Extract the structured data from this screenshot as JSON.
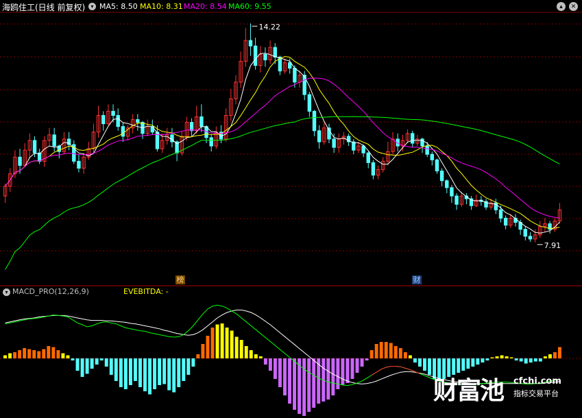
{
  "header": {
    "title": "海鸥住工(日线 前复权)",
    "ma5": "MA5: 8.50",
    "ma10": "MA10: 8.31",
    "ma20": "MA20: 8.54",
    "ma60": "MA60: 9.55",
    "ma5_color": "#ffffff",
    "ma10_color": "#ffff00",
    "ma20_color": "#ff00ff",
    "ma60_color": "#00ff00"
  },
  "panel2": {
    "title": "MACD_PRO(12,26,9)",
    "indicator": "EVEBITDA: -"
  },
  "markers": {
    "bang": "榜",
    "cai": "财"
  },
  "watermark": {
    "brand": "财富池",
    "domain": "cfchi.com",
    "slogan": "指标交易平台"
  },
  "icons": [
    "chevron-down-icon",
    "up-icon",
    "close-icon"
  ],
  "colors": {
    "up": "#ff3232",
    "down": "#54ffff",
    "grid": "#7f0000",
    "hist_up_1": "#ff6a00",
    "hist_up_2": "#ffff00",
    "hist_down_1": "#54ffff",
    "hist_down_2": "#cc66ff"
  },
  "chart_data": [
    {
      "type": "candlestick",
      "title": "海鸥住工(日线 前复权)",
      "annotations": [
        {
          "label": "14.22",
          "note": "high"
        },
        {
          "label": "7.91",
          "note": "low"
        }
      ],
      "ylim": [
        7.0,
        14.5
      ],
      "series": [
        {
          "name": "MA5",
          "value": 8.5
        },
        {
          "name": "MA10",
          "value": 8.31
        },
        {
          "name": "MA20",
          "value": 8.54
        },
        {
          "name": "MA60",
          "value": 9.55
        }
      ],
      "candles": [
        [
          9.25,
          9.53,
          9.05,
          9.61
        ],
        [
          9.53,
          9.89,
          9.37,
          10.05
        ],
        [
          9.89,
          10.37,
          9.77,
          10.57
        ],
        [
          10.37,
          10.13,
          9.89,
          10.61
        ],
        [
          10.13,
          10.57,
          10.09,
          10.77
        ],
        [
          10.57,
          10.85,
          10.33,
          11.05
        ],
        [
          10.85,
          10.49,
          10.37,
          10.97
        ],
        [
          10.49,
          10.25,
          10.17,
          10.61
        ],
        [
          10.25,
          10.85,
          10.09,
          10.97
        ],
        [
          10.85,
          11.01,
          10.69,
          11.21
        ],
        [
          11.01,
          10.69,
          10.53,
          11.21
        ],
        [
          10.69,
          10.53,
          10.33,
          10.73
        ],
        [
          10.53,
          10.89,
          10.45,
          11.09
        ],
        [
          10.89,
          10.73,
          10.57,
          11.09
        ],
        [
          10.73,
          10.25,
          10.17,
          10.85
        ],
        [
          10.25,
          10.05,
          9.93,
          10.45
        ],
        [
          10.05,
          10.37,
          9.89,
          10.49
        ],
        [
          10.37,
          10.61,
          10.29,
          10.81
        ],
        [
          10.61,
          11.09,
          10.49,
          11.33
        ],
        [
          11.09,
          11.57,
          10.93,
          11.85
        ],
        [
          11.57,
          11.33,
          11.13,
          11.69
        ],
        [
          11.33,
          11.69,
          11.29,
          11.89
        ],
        [
          11.69,
          11.57,
          11.37,
          11.89
        ],
        [
          11.57,
          11.25,
          11.13,
          11.77
        ],
        [
          11.25,
          10.97,
          10.81,
          11.37
        ],
        [
          10.97,
          11.21,
          10.85,
          11.29
        ],
        [
          11.21,
          11.45,
          11.05,
          11.61
        ],
        [
          11.45,
          11.37,
          11.13,
          11.61
        ],
        [
          11.37,
          11.05,
          10.89,
          11.41
        ],
        [
          11.05,
          11.25,
          10.97,
          11.45
        ],
        [
          11.25,
          11.09,
          11.01,
          11.45
        ],
        [
          11.09,
          10.61,
          10.53,
          11.29
        ],
        [
          10.61,
          10.85,
          10.49,
          11.05
        ],
        [
          10.85,
          11.01,
          10.73,
          11.21
        ],
        [
          11.01,
          10.81,
          10.65,
          11.21
        ],
        [
          10.81,
          10.49,
          10.25,
          10.85
        ],
        [
          10.49,
          10.97,
          10.41,
          11.13
        ],
        [
          10.97,
          11.37,
          10.85,
          11.53
        ],
        [
          11.37,
          11.13,
          10.97,
          11.49
        ],
        [
          11.13,
          11.53,
          11.05,
          11.85
        ],
        [
          11.53,
          11.25,
          11.09,
          11.89
        ],
        [
          11.25,
          10.93,
          10.77,
          11.29
        ],
        [
          10.93,
          10.69,
          10.53,
          11.01
        ],
        [
          10.69,
          11.09,
          10.61,
          11.25
        ],
        [
          11.09,
          10.89,
          10.77,
          11.29
        ],
        [
          10.89,
          11.57,
          10.81,
          11.77
        ],
        [
          11.57,
          12.05,
          11.41,
          12.33
        ],
        [
          12.05,
          12.53,
          11.89,
          12.73
        ],
        [
          12.53,
          13.13,
          12.37,
          13.41
        ],
        [
          13.13,
          13.73,
          12.97,
          14.09
        ],
        [
          13.73,
          13.57,
          13.29,
          14.22
        ],
        [
          13.57,
          13.01,
          12.89,
          13.81
        ],
        [
          13.01,
          13.33,
          12.81,
          13.57
        ],
        [
          13.33,
          13.17,
          12.97,
          13.53
        ],
        [
          13.17,
          13.53,
          13.05,
          13.73
        ],
        [
          13.53,
          13.25,
          13.05,
          13.65
        ],
        [
          13.25,
          12.85,
          12.73,
          13.29
        ],
        [
          12.85,
          13.09,
          12.77,
          13.21
        ],
        [
          13.09,
          12.93,
          12.77,
          13.21
        ],
        [
          12.93,
          12.53,
          12.37,
          13.01
        ],
        [
          12.53,
          12.73,
          12.37,
          12.85
        ],
        [
          12.73,
          12.17,
          12.01,
          12.85
        ],
        [
          12.17,
          11.69,
          11.53,
          12.25
        ],
        [
          11.69,
          11.13,
          10.97,
          11.73
        ],
        [
          11.13,
          10.81,
          10.61,
          11.29
        ],
        [
          10.81,
          11.21,
          10.73,
          11.37
        ],
        [
          11.21,
          10.89,
          10.77,
          11.33
        ],
        [
          10.89,
          10.65,
          10.49,
          11.05
        ],
        [
          10.65,
          10.89,
          10.49,
          11.05
        ],
        [
          10.89,
          10.97,
          10.73,
          11.09
        ],
        [
          10.97,
          10.81,
          10.69,
          11.05
        ],
        [
          10.81,
          10.57,
          10.45,
          10.89
        ],
        [
          10.57,
          10.69,
          10.49,
          10.81
        ],
        [
          10.69,
          10.49,
          10.37,
          10.73
        ],
        [
          10.49,
          10.21,
          10.05,
          10.53
        ],
        [
          10.21,
          9.85,
          9.73,
          10.29
        ],
        [
          9.85,
          10.01,
          9.73,
          10.13
        ],
        [
          10.01,
          10.25,
          9.93,
          10.37
        ],
        [
          10.25,
          10.53,
          10.13,
          10.81
        ],
        [
          10.53,
          10.89,
          10.45,
          11.09
        ],
        [
          10.89,
          10.69,
          10.53,
          11.05
        ],
        [
          10.69,
          10.85,
          10.53,
          11.01
        ],
        [
          10.85,
          11.05,
          10.77,
          11.17
        ],
        [
          11.05,
          10.77,
          10.65,
          11.13
        ],
        [
          10.77,
          10.89,
          10.69,
          11.01
        ],
        [
          10.89,
          10.69,
          10.49,
          10.93
        ],
        [
          10.69,
          10.45,
          10.37,
          10.81
        ],
        [
          10.45,
          10.29,
          10.13,
          10.53
        ],
        [
          10.29,
          9.97,
          9.89,
          10.33
        ],
        [
          9.97,
          9.69,
          9.53,
          10.05
        ],
        [
          9.69,
          9.49,
          9.33,
          9.73
        ],
        [
          9.49,
          9.25,
          9.05,
          9.57
        ],
        [
          9.25,
          9.01,
          8.85,
          9.33
        ],
        [
          9.01,
          9.25,
          8.93,
          9.37
        ],
        [
          9.25,
          9.17,
          9.01,
          9.33
        ],
        [
          9.17,
          8.97,
          8.85,
          9.25
        ],
        [
          8.97,
          9.13,
          8.93,
          9.29
        ],
        [
          9.13,
          9.09,
          8.97,
          9.25
        ],
        [
          9.09,
          8.93,
          8.85,
          9.17
        ],
        [
          8.93,
          9.05,
          8.85,
          9.17
        ],
        [
          9.05,
          8.85,
          8.73,
          9.17
        ],
        [
          8.85,
          8.61,
          8.49,
          8.97
        ],
        [
          8.61,
          8.41,
          8.29,
          8.69
        ],
        [
          8.41,
          8.61,
          8.33,
          8.73
        ],
        [
          8.61,
          8.49,
          8.37,
          8.73
        ],
        [
          8.49,
          8.29,
          8.13,
          8.57
        ],
        [
          8.29,
          8.09,
          7.97,
          8.37
        ],
        [
          8.09,
          8.01,
          7.93,
          8.21
        ],
        [
          8.01,
          8.13,
          7.91,
          8.29
        ],
        [
          8.13,
          8.37,
          8.05,
          8.53
        ],
        [
          8.37,
          8.45,
          8.21,
          8.61
        ],
        [
          8.45,
          8.29,
          8.17,
          8.53
        ],
        [
          8.29,
          8.53,
          8.21,
          8.61
        ],
        [
          8.53,
          8.85,
          8.45,
          9.05
        ]
      ]
    },
    {
      "type": "bar",
      "title": "MACD_PRO(12,26,9)",
      "series": [
        {
          "name": "MACD",
          "values": [
            0.03,
            0.05,
            0.06,
            0.08,
            0.1,
            0.09,
            0.08,
            0.07,
            0.09,
            0.12,
            0.11,
            0.08,
            0.05,
            0.03,
            -0.02,
            -0.12,
            -0.18,
            -0.15,
            -0.1,
            -0.06,
            -0.02,
            -0.08,
            -0.16,
            -0.22,
            -0.28,
            -0.3,
            -0.26,
            -0.22,
            -0.28,
            -0.32,
            -0.35,
            -0.3,
            -0.26,
            -0.25,
            -0.31,
            -0.33,
            -0.28,
            -0.22,
            -0.16,
            -0.08,
            0.04,
            0.14,
            0.22,
            0.3,
            0.33,
            0.34,
            0.3,
            0.27,
            0.21,
            0.18,
            0.12,
            0.08,
            0.04,
            0.02,
            -0.06,
            -0.12,
            -0.2,
            -0.28,
            -0.36,
            -0.44,
            -0.5,
            -0.54,
            -0.56,
            -0.52,
            -0.48,
            -0.44,
            -0.42,
            -0.4,
            -0.36,
            -0.3,
            -0.26,
            -0.24,
            -0.2,
            -0.14,
            -0.08,
            -0.02,
            0.08,
            0.14,
            0.16,
            0.16,
            0.15,
            0.12,
            0.1,
            0.06,
            0.03,
            -0.04,
            -0.08,
            -0.12,
            -0.16,
            -0.2,
            -0.22,
            -0.2,
            -0.18,
            -0.16,
            -0.14,
            -0.12,
            -0.1,
            -0.08,
            -0.06,
            -0.04,
            -0.02,
            0.01,
            0.02,
            0.03,
            0.02,
            0.01,
            -0.02,
            -0.03,
            -0.05,
            -0.04,
            -0.03,
            -0.03,
            0.02,
            0.04,
            0.06,
            0.11
          ]
        },
        {
          "name": "DIF",
          "values": [
            0.7,
            0.72,
            0.74,
            0.76,
            0.78,
            0.8,
            0.81,
            0.82,
            0.84,
            0.86,
            0.88,
            0.87,
            0.86,
            0.84,
            0.78,
            0.72,
            0.68,
            0.64,
            0.66,
            0.7,
            0.73,
            0.74,
            0.72,
            0.7,
            0.66,
            0.62,
            0.6,
            0.58,
            0.56,
            0.55,
            0.52,
            0.5,
            0.48,
            0.46,
            0.44,
            0.43,
            0.44,
            0.48,
            0.56,
            0.66,
            0.78,
            0.9,
            1.0,
            1.06,
            1.08,
            1.06,
            1.02,
            0.96,
            0.9,
            0.82,
            0.74,
            0.66,
            0.58,
            0.5,
            0.42,
            0.34,
            0.26,
            0.18,
            0.1,
            0.02,
            -0.06,
            -0.14,
            -0.22,
            -0.28,
            -0.34,
            -0.4,
            -0.44,
            -0.48,
            -0.5,
            -0.52,
            -0.54,
            -0.55,
            -0.53,
            -0.5,
            -0.46,
            -0.4,
            -0.34,
            -0.28,
            -0.22,
            -0.18,
            -0.16,
            -0.16,
            -0.17,
            -0.2,
            -0.23,
            -0.27,
            -0.31,
            -0.35,
            -0.39,
            -0.43,
            -0.46,
            -0.48,
            -0.5,
            -0.51,
            -0.52,
            -0.53,
            -0.53,
            -0.53,
            -0.52,
            -0.51,
            -0.5,
            -0.49,
            -0.48,
            -0.48,
            -0.48,
            -0.49,
            -0.5,
            -0.51,
            -0.52,
            -0.52,
            -0.51,
            -0.5,
            -0.48,
            -0.46,
            -0.44,
            -0.42
          ]
        },
        {
          "name": "DEA",
          "values": [
            0.72,
            0.74,
            0.76,
            0.78,
            0.8,
            0.81,
            0.82,
            0.84,
            0.85,
            0.86,
            0.87,
            0.87,
            0.87,
            0.86,
            0.84,
            0.82,
            0.8,
            0.78,
            0.77,
            0.77,
            0.77,
            0.76,
            0.76,
            0.75,
            0.74,
            0.73,
            0.71,
            0.7,
            0.68,
            0.66,
            0.64,
            0.62,
            0.6,
            0.57,
            0.55,
            0.52,
            0.5,
            0.48,
            0.47,
            0.48,
            0.52,
            0.58,
            0.66,
            0.74,
            0.82,
            0.88,
            0.93,
            0.96,
            0.98,
            0.98,
            0.96,
            0.93,
            0.88,
            0.82,
            0.75,
            0.68,
            0.6,
            0.52,
            0.44,
            0.36,
            0.28,
            0.2,
            0.12,
            0.04,
            -0.04,
            -0.12,
            -0.2,
            -0.26,
            -0.32,
            -0.37,
            -0.42,
            -0.46,
            -0.49,
            -0.51,
            -0.52,
            -0.51,
            -0.49,
            -0.46,
            -0.42,
            -0.38,
            -0.34,
            -0.31,
            -0.28,
            -0.27,
            -0.27,
            -0.28,
            -0.3,
            -0.32,
            -0.35,
            -0.38,
            -0.41,
            -0.43,
            -0.45,
            -0.47,
            -0.48,
            -0.49,
            -0.5,
            -0.51,
            -0.51,
            -0.51,
            -0.51,
            -0.51,
            -0.51,
            -0.51,
            -0.51,
            -0.51,
            -0.51,
            -0.51,
            -0.51,
            -0.51,
            -0.51,
            -0.51,
            -0.5,
            -0.49,
            -0.48,
            -0.47
          ]
        }
      ]
    }
  ]
}
